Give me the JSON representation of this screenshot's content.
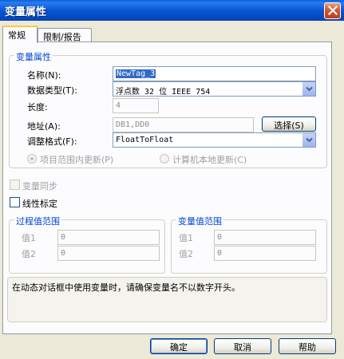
{
  "window": {
    "title": "变量属性",
    "close_icon": "close-icon"
  },
  "tabs": [
    {
      "label": "常规",
      "active": true
    },
    {
      "label": "限制/报告",
      "active": false
    }
  ],
  "variable_group": {
    "title": "变量属性",
    "name_label": "名称(N):",
    "name_value": "NewTag_3",
    "type_label": "数据类型(T):",
    "type_value": "浮点数 32 位 IEEE 754",
    "length_label": "长度:",
    "length_value": "4",
    "address_label": "地址(A):",
    "address_value": "DB1,DD0",
    "select_button": "选择(S)",
    "format_label": "调整格式(F):",
    "format_value": "FloatToFloat",
    "radio_project": "项目范围内更新(P)",
    "radio_local": "计算机本地更新(C)"
  },
  "sync_checkbox": "变量同步",
  "linear_checkbox": "线性标定",
  "process_range": {
    "title": "过程值范围",
    "value1_label": "值1",
    "value1": "0",
    "value2_label": "值2",
    "value2": "0"
  },
  "variable_range": {
    "title": "变量值范围",
    "value1_label": "值1",
    "value1": "0",
    "value2_label": "值2",
    "value2": "0"
  },
  "note": "在动态对话框中使用变量时，请确保变量名不以数字开头。",
  "buttons": {
    "ok": "确定",
    "cancel": "取消",
    "help": "帮助"
  }
}
